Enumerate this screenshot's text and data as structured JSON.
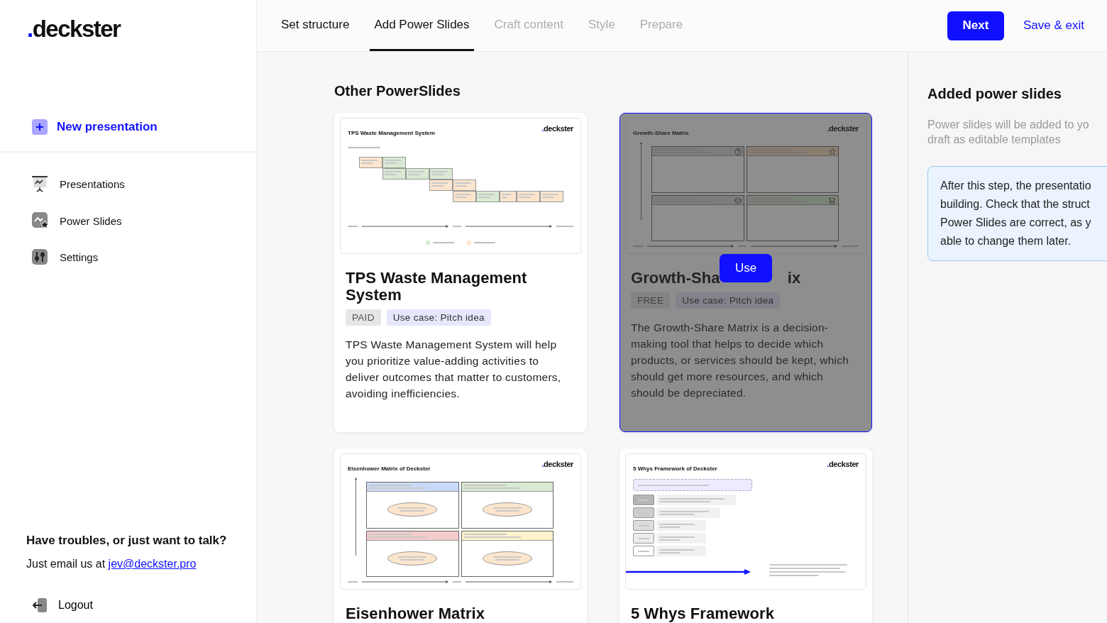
{
  "sidebar": {
    "logo": {
      "dot": ".",
      "name": "deckster"
    },
    "new_button": {
      "label": "New presentation"
    },
    "nav": [
      {
        "label": "Presentations"
      },
      {
        "label": "Power Slides"
      },
      {
        "label": "Settings"
      }
    ],
    "help": {
      "heading": "Have troubles, or just want to talk?",
      "text": "Just email us at",
      "email": "jev@deckster.pro"
    },
    "logout": {
      "label": "Logout"
    }
  },
  "steps": [
    {
      "label": "Set structure",
      "selected": false,
      "available": true
    },
    {
      "label": "Add Power Slides",
      "selected": true,
      "available": true
    },
    {
      "label": "Craft content",
      "selected": false,
      "available": false
    },
    {
      "label": "Style",
      "selected": false,
      "available": false
    },
    {
      "label": "Prepare",
      "selected": false,
      "available": false
    }
  ],
  "actions": {
    "next": "Next",
    "save": "Save & exit"
  },
  "main": {
    "heading": "Other PowerSlides",
    "cards": [
      {
        "title": "TPS Waste Management System",
        "hovered": false,
        "tags": [
          {
            "text": "PAID",
            "kind": "price"
          },
          {
            "text": "Use case: Pitch idea",
            "kind": "use-case"
          }
        ],
        "description": "TPS Waste Management System will help you prioritize value-adding activities to deliver outcomes that matter to customers, avoiding inefficiencies.",
        "preview": {
          "kind": "steps",
          "title": "TPS Waste Management System",
          "brand": {
            "dot": ".",
            "name": "deckster"
          },
          "steps": [
            {
              "value_added": false
            },
            {
              "value_added": true
            },
            {
              "value_added": true
            },
            {
              "value_added": true
            },
            {
              "value_added": true
            },
            {
              "value_added": false
            },
            {
              "value_added": false
            },
            {
              "value_added": false
            },
            {
              "value_added": true
            },
            {
              "value_added": false
            },
            {
              "value_added": false
            },
            {
              "value_added": false
            }
          ],
          "legend": [
            {
              "value_added": true
            },
            {
              "value_added": false
            }
          ]
        }
      },
      {
        "title": "Growth-Sha",
        "title_end": "ix",
        "hovered": true,
        "action": "Use",
        "tags": [
          {
            "text": "FREE",
            "kind": "price"
          },
          {
            "text": "Use case: Pitch idea",
            "kind": "use-case"
          }
        ],
        "description": "The Growth-Share Matrix is a decision-making tool that helps to decide which products, or services should be kept, which should get more resources, and which should be depreciated.",
        "preview": {
          "kind": "quadrants",
          "title": "Growth-Share Matrix",
          "brand": {
            "dot": ".",
            "name": "deckster"
          },
          "quadrants": [
            {
              "kind": "question"
            },
            {
              "kind": "star"
            },
            {
              "kind": "dog"
            },
            {
              "kind": "cow"
            }
          ]
        }
      },
      {
        "title": "Eisenhower Matrix",
        "hovered": false,
        "preview": {
          "kind": "quadrants",
          "title": "Eisenhower Matrix of Deckster",
          "brand": {
            "dot": ".",
            "name": "deckster"
          },
          "quadrants": [
            {
              "kind": "effectiveness"
            },
            {
              "kind": "necessity"
            },
            {
              "kind": "waste"
            },
            {
              "kind": "distraction"
            }
          ]
        }
      },
      {
        "title": "5 Whys Framework",
        "hovered": false,
        "preview": {
          "kind": "whys",
          "title": "5 Whys Framework of Deckster",
          "brand": {
            "dot": ".",
            "name": "deckster"
          }
        }
      }
    ]
  },
  "panel": {
    "heading": "Added power slides",
    "note": "Power slides will be added to yo\ndraft as editable templates",
    "info": "After this step, the presentatio\nbuilding. Check that the struct\nPower Slides are correct, as y\nable to change them later."
  }
}
